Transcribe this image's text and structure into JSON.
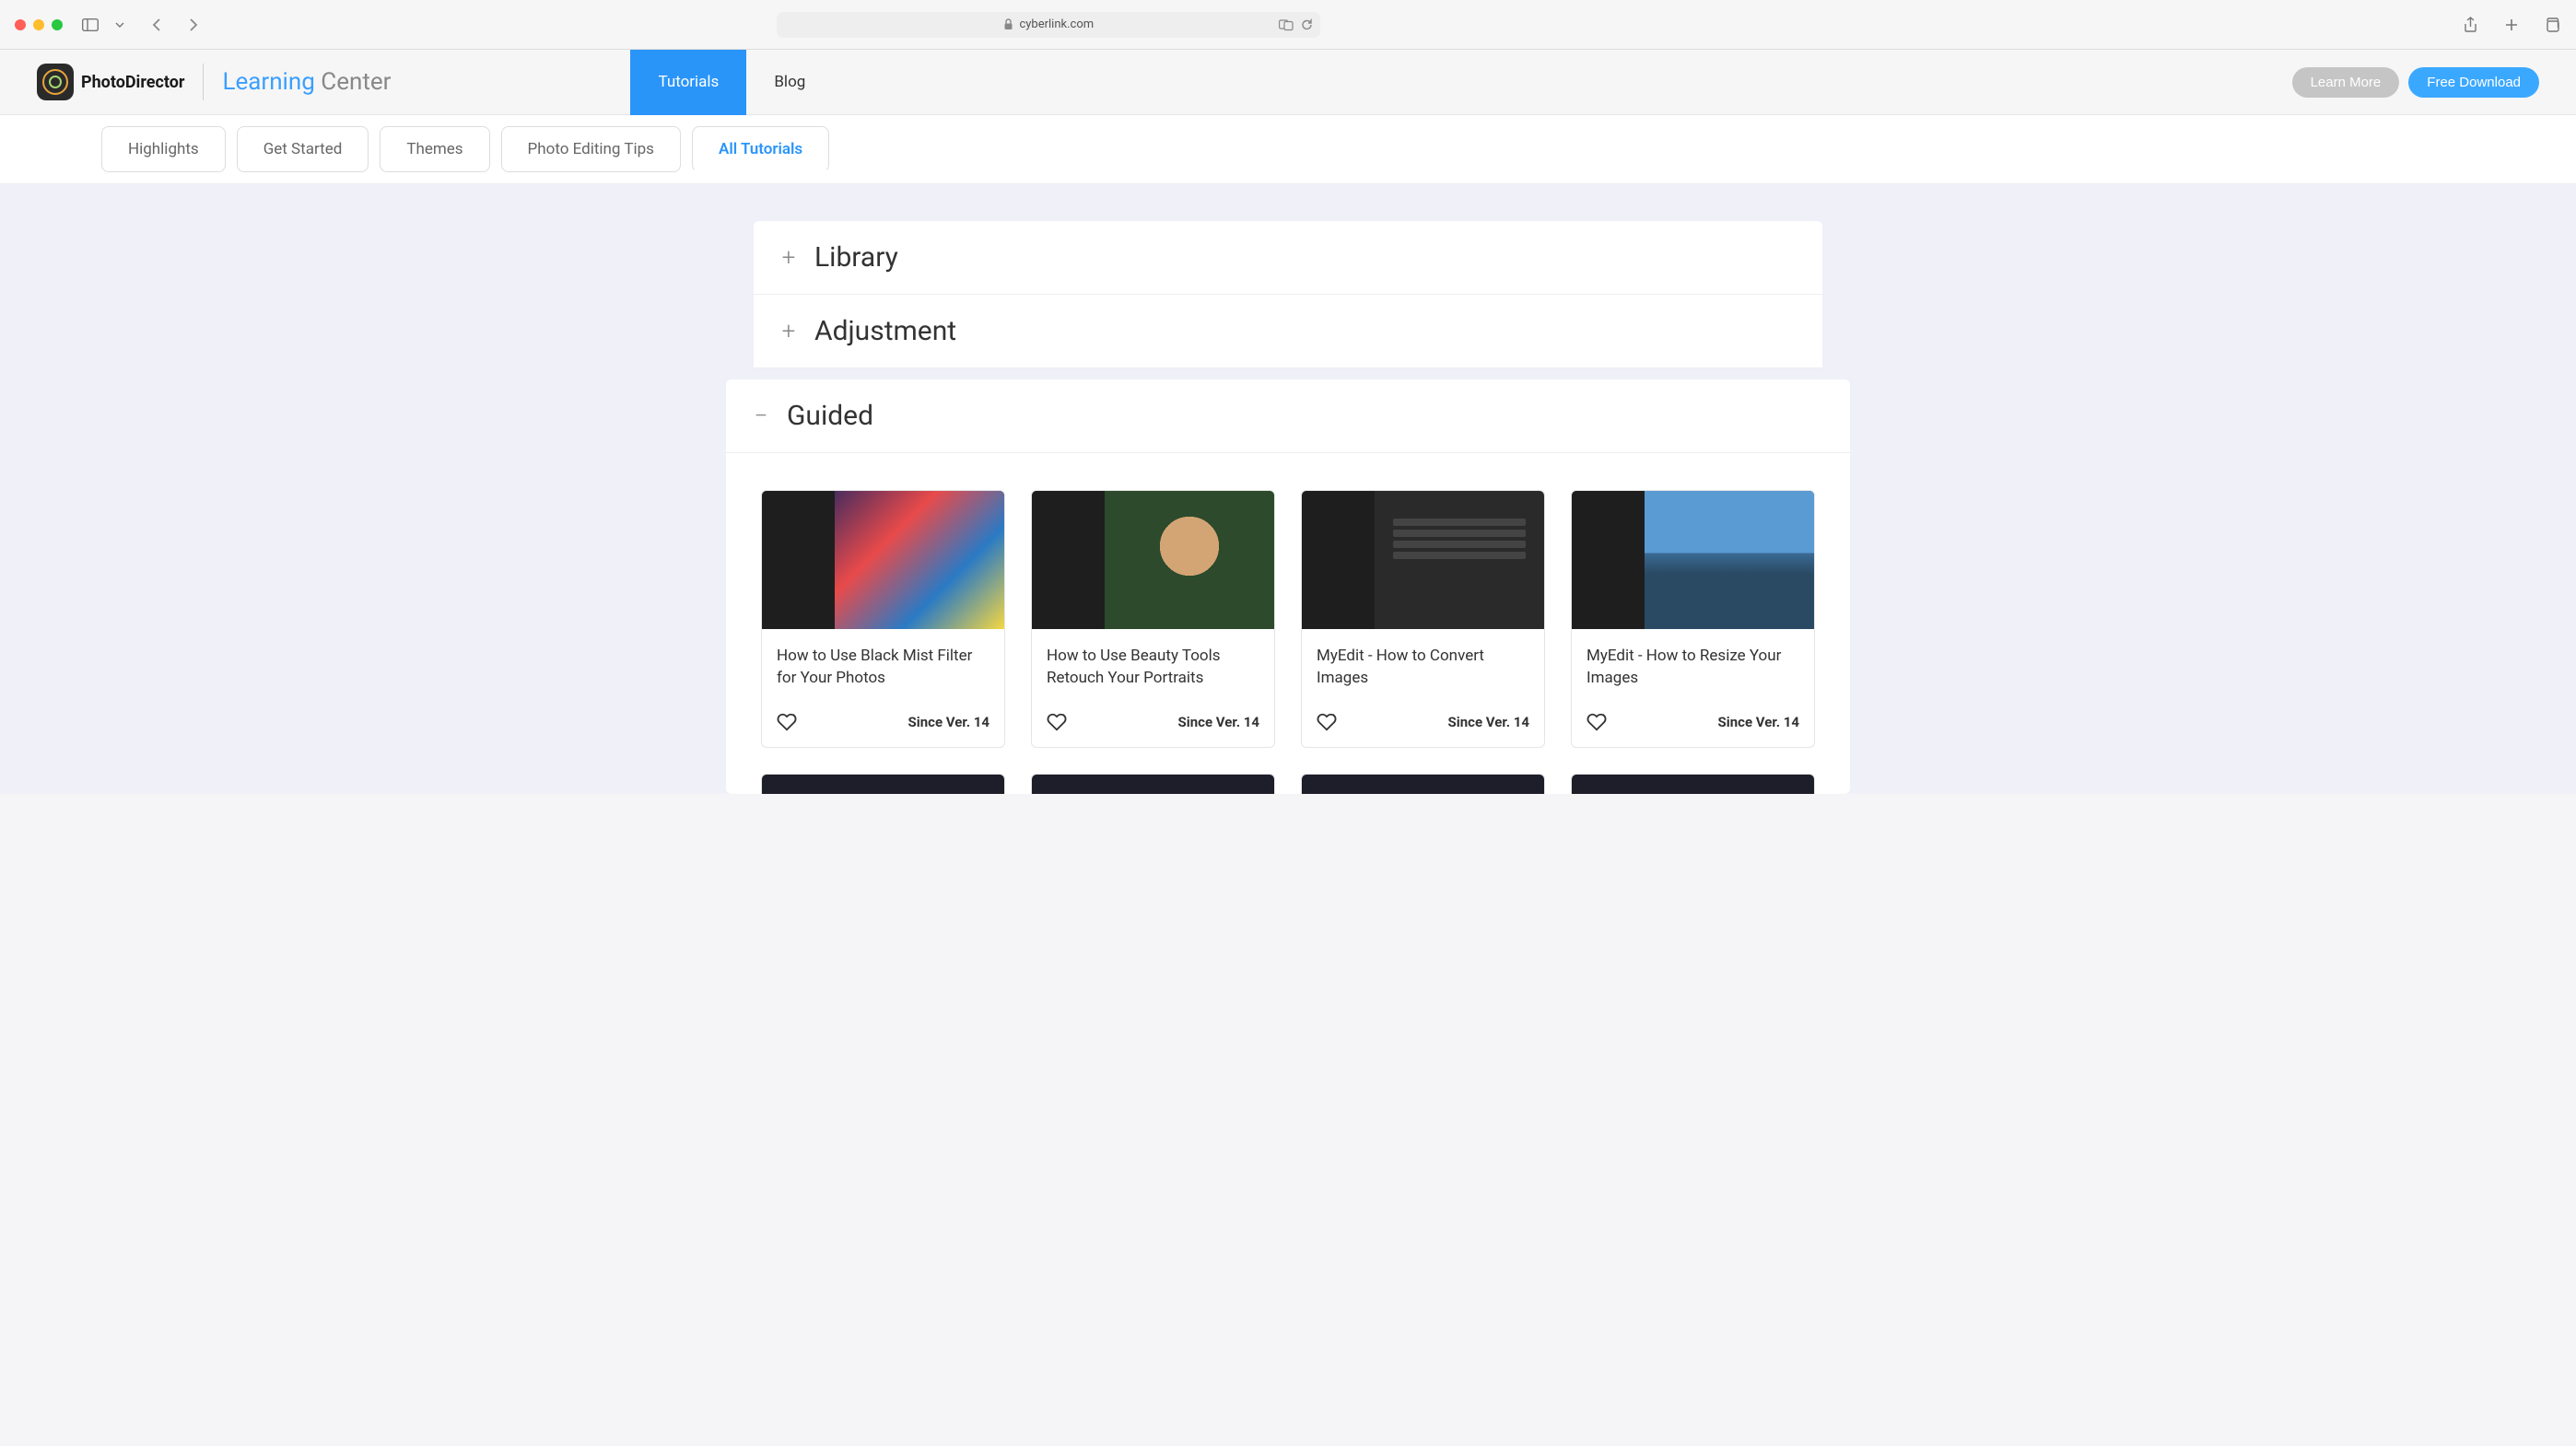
{
  "browser": {
    "url": "cyberlink.com"
  },
  "header": {
    "logo_text": "PhotoDirector",
    "learning_label_1": "Learning",
    "learning_label_2": "Center",
    "nav_tabs": [
      {
        "label": "Tutorials",
        "active": true
      },
      {
        "label": "Blog",
        "active": false
      }
    ],
    "learn_more": "Learn More",
    "free_download": "Free Download"
  },
  "sub_tabs": [
    {
      "label": "Highlights",
      "active": false
    },
    {
      "label": "Get Started",
      "active": false
    },
    {
      "label": "Themes",
      "active": false
    },
    {
      "label": "Photo Editing Tips",
      "active": false
    },
    {
      "label": "All Tutorials",
      "active": true
    }
  ],
  "accordion": [
    {
      "icon": "+",
      "title": "Library"
    },
    {
      "icon": "+",
      "title": "Adjustment"
    }
  ],
  "guided": {
    "icon": "−",
    "title": "Guided",
    "cards": [
      {
        "title": "How to Use Black Mist Filter for Your Photos",
        "version": "Since Ver. 14"
      },
      {
        "title": "How to Use Beauty Tools Retouch Your Portraits",
        "version": "Since Ver. 14"
      },
      {
        "title": "MyEdit - How to Convert Images",
        "version": "Since Ver. 14"
      },
      {
        "title": "MyEdit - How to Resize Your Images",
        "version": "Since Ver. 14"
      }
    ]
  }
}
